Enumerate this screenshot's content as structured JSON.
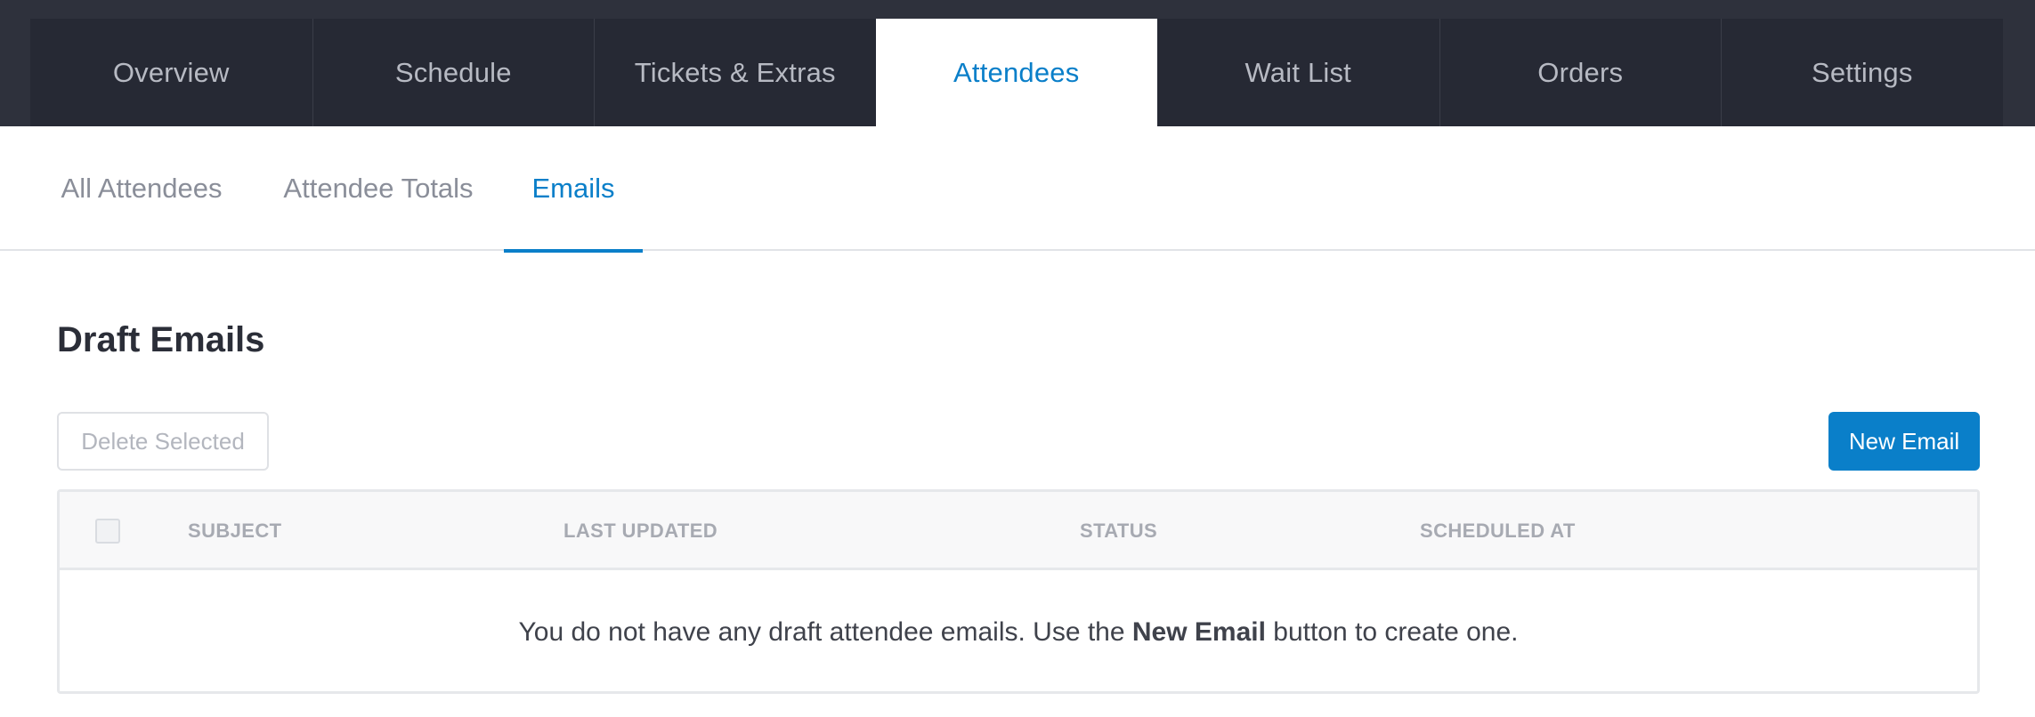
{
  "top_tabs": [
    {
      "label": "Overview"
    },
    {
      "label": "Schedule"
    },
    {
      "label": "Tickets & Extras"
    },
    {
      "label": "Attendees",
      "active": true
    },
    {
      "label": "Wait List"
    },
    {
      "label": "Orders"
    },
    {
      "label": "Settings"
    }
  ],
  "sub_tabs": [
    {
      "label": "All Attendees"
    },
    {
      "label": "Attendee Totals"
    },
    {
      "label": "Emails",
      "active": true
    }
  ],
  "section": {
    "title": "Draft Emails"
  },
  "buttons": {
    "delete_selected": "Delete Selected",
    "new_email": "New Email"
  },
  "table": {
    "columns": [
      "SUBJECT",
      "LAST UPDATED",
      "STATUS",
      "SCHEDULED AT"
    ],
    "empty_message": {
      "before": "You do not have any draft attendee emails. Use the ",
      "bold": "New Email",
      "after": " button to create one."
    }
  },
  "colors": {
    "accent": "#0a7fc9",
    "topbar_bg": "#2e313c",
    "tab_bg": "#262934"
  }
}
